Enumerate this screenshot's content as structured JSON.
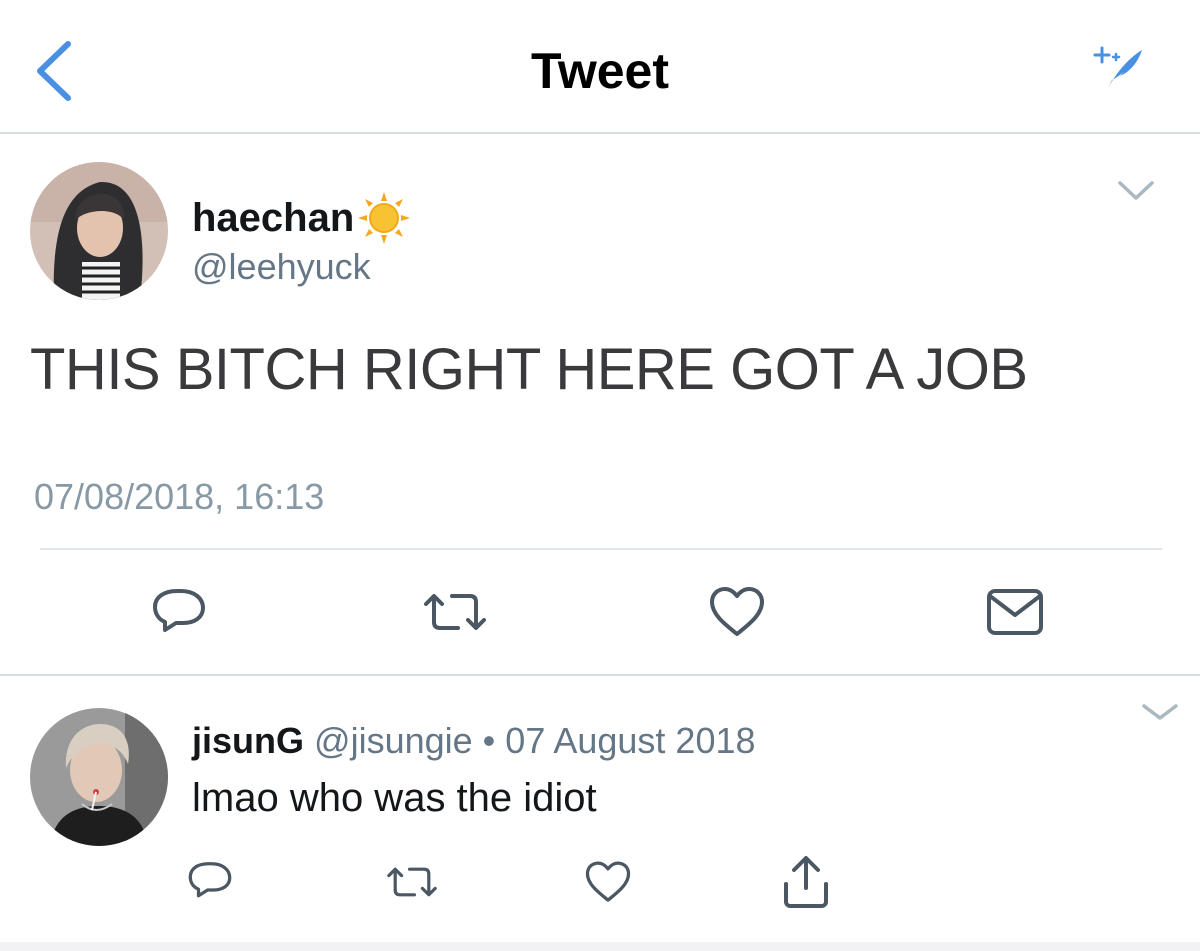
{
  "navbar": {
    "title": "Tweet",
    "back_icon": "chevron-left-icon",
    "compose_icon": "compose-sparkle-icon",
    "accent_color": "#4a90e2"
  },
  "main_tweet": {
    "display_name": "haechan",
    "name_emoji_icon": "sun-icon",
    "handle": "@leehyuck",
    "text": "THIS BITCH RIGHT HERE GOT A JOB",
    "timestamp": "07/08/2018, 16:13",
    "actions": [
      "reply-icon",
      "retweet-icon",
      "like-icon",
      "direct-message-icon"
    ]
  },
  "reply": {
    "display_name": "jisunG",
    "handle": "@jisungie",
    "separator": "•",
    "date": "07 August 2018",
    "text": "lmao who was the idiot",
    "actions": [
      "reply-icon",
      "retweet-icon",
      "like-icon",
      "share-icon"
    ]
  }
}
